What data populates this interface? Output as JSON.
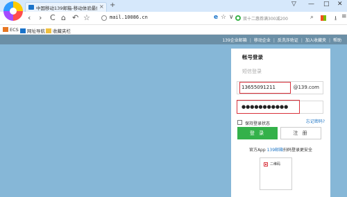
{
  "tab": {
    "title": "中国移动139邮箱-移动体验最佳...",
    "close": "×"
  },
  "new_tab": "+",
  "window": {
    "skin": "▽",
    "minimize": "—",
    "maximize": "□",
    "close": "✕"
  },
  "toolbar": {
    "back": "‹",
    "forward": "›",
    "reload": "C",
    "home": "⌂",
    "undo": "↶",
    "star": "☆",
    "url": "mail.10086.cn",
    "ie_icon": "e",
    "fav_icon": "☆",
    "dropdown": "∨",
    "search_placeholder": "双十二惠券满300减200",
    "search_icon": "search-icon",
    "download_icon": "⭳",
    "menu_icon": "≡"
  },
  "bookmarks": [
    {
      "label": "ECS",
      "icon": "ecs-icon",
      "color": "#e87722"
    },
    {
      "label": "网址导航",
      "icon": "nav-icon",
      "color": "#1a73c9"
    },
    {
      "label": "收藏夹栏",
      "icon": "folder-icon",
      "color": "#f0c040"
    }
  ],
  "topnav": {
    "links": [
      "139企业邮箱",
      "移动企业",
      "反洗诈劝证",
      "加入收藏夹",
      "帮助"
    ]
  },
  "login": {
    "account_tab": "帐号登录",
    "sms_tab": "短信登录",
    "username": "13655091211",
    "domain_suffix": "@139.com",
    "password": "●●●●●●●●●●●",
    "remember": "保持登录状态",
    "forgot": "忘记密码?",
    "login_button": "登 录",
    "register_button": "注 册",
    "promo_prefix": "官方App",
    "promo_link": "139邮箱",
    "promo_suffix": "扫码登录更安全",
    "qr_label": "二维码"
  },
  "colors": {
    "page_bg": "#86b7d7",
    "topnav_bg": "#6b8fa6",
    "login_green": "#34b14a",
    "highlight_red": "#d8303a",
    "link_blue": "#1f75c4"
  }
}
